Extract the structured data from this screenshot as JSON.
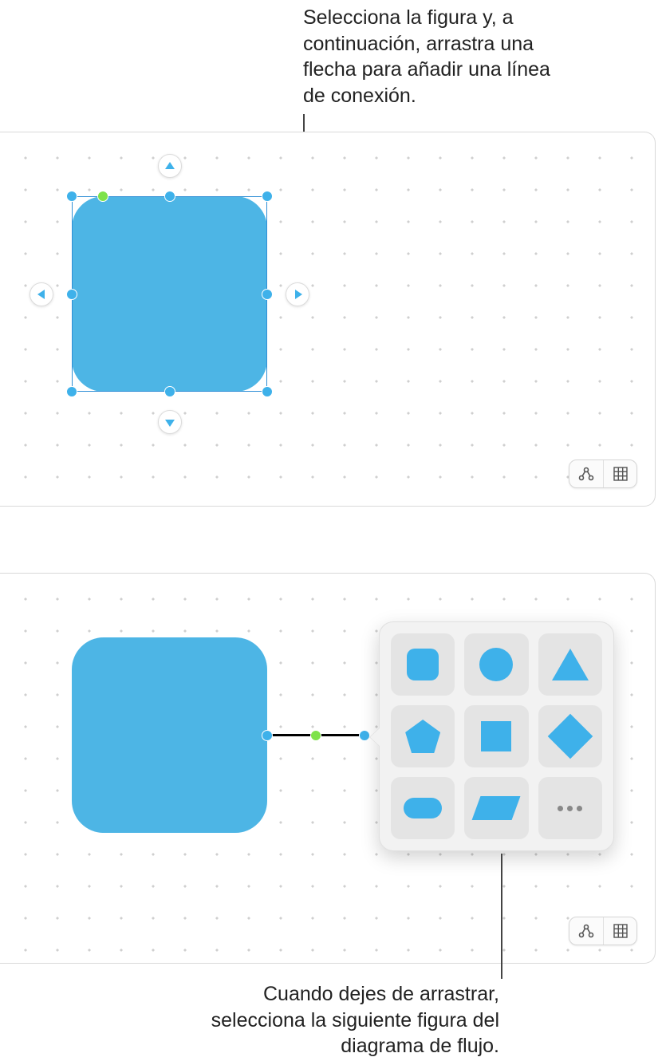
{
  "callouts": {
    "top": "Selecciona la figura y, a continuación, arrastra una flecha para añadir una línea de conexión.",
    "bottom": "Cuando dejes de arrastrar, selecciona la siguiente figura del diagrama de flujo."
  },
  "shapes_picker": {
    "items": [
      "rounded-square",
      "circle",
      "triangle",
      "pentagon",
      "square",
      "diamond",
      "capsule",
      "parallelogram",
      "more"
    ]
  },
  "toolbar": {
    "buttons": [
      "diagram-mode",
      "grid-toggle"
    ]
  }
}
